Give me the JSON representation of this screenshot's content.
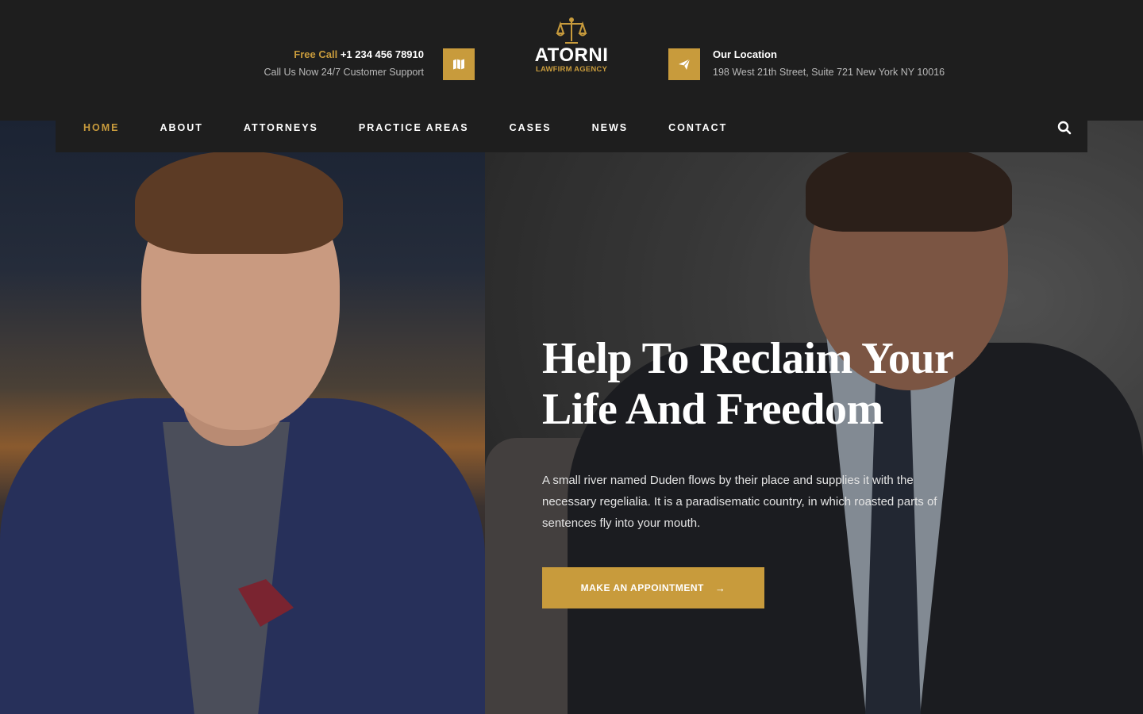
{
  "header": {
    "phone": {
      "label": "Free Call",
      "number": "+1 234 456 78910",
      "sub": "Call Us Now 24/7 Customer Support"
    },
    "logo": {
      "name": "ATORNI",
      "tagline": "LAWFIRM AGENCY"
    },
    "location": {
      "label": "Our Location",
      "address": "198 West 21th Street, Suite 721 New York NY 10016"
    }
  },
  "nav": {
    "items": [
      {
        "label": "HOME",
        "active": true
      },
      {
        "label": "ABOUT"
      },
      {
        "label": "ATTORNEYS"
      },
      {
        "label": "PRACTICE AREAS"
      },
      {
        "label": "CASES"
      },
      {
        "label": "NEWS"
      },
      {
        "label": "CONTACT"
      }
    ],
    "search_icon": "search-icon"
  },
  "hero": {
    "title_line1": "Help To Reclaim Your",
    "title_line2": "Life And Freedom",
    "text": "A small river named Duden flows by their place and supplies it with the necessary regelialia. It is a paradisematic country, in which roasted parts of sentences fly into your mouth.",
    "cta_label": "MAKE AN APPOINTMENT",
    "cta_arrow": "→"
  },
  "colors": {
    "accent": "#c89b3c",
    "dark": "#1e1e1e"
  }
}
